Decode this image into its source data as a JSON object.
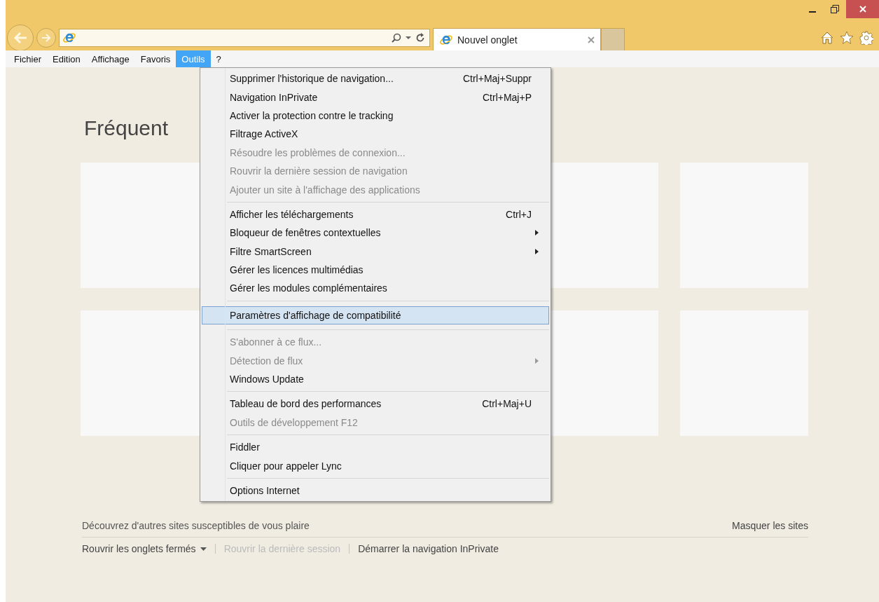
{
  "tab": {
    "title": "Nouvel onglet"
  },
  "menubar": [
    {
      "label": "Fichier",
      "selected": false
    },
    {
      "label": "Edition",
      "selected": false
    },
    {
      "label": "Affichage",
      "selected": false
    },
    {
      "label": "Favoris",
      "selected": false
    },
    {
      "label": "Outils",
      "selected": true
    },
    {
      "label": "?",
      "selected": false
    }
  ],
  "page": {
    "heading": "Fréquent",
    "discover": "Découvrez d'autres sites susceptibles de vous plaire",
    "hide_sites": "Masquer les sites",
    "links": [
      {
        "label": "Rouvrir les onglets fermés",
        "disabled": false,
        "dropdown": true
      },
      {
        "label": "Rouvrir la dernière session",
        "disabled": true,
        "dropdown": false
      },
      {
        "label": "Démarrer la navigation InPrivate",
        "disabled": false,
        "dropdown": false
      }
    ]
  },
  "menu": [
    {
      "kind": "item",
      "label": "Supprimer l'historique de navigation...",
      "shortcut": "Ctrl+Maj+Suppr",
      "disabled": false,
      "selected": false
    },
    {
      "kind": "item",
      "label": "Navigation InPrivate",
      "shortcut": "Ctrl+Maj+P",
      "disabled": false,
      "selected": false
    },
    {
      "kind": "item",
      "label": "Activer la protection contre le tracking",
      "disabled": false,
      "selected": false
    },
    {
      "kind": "item",
      "label": "Filtrage ActiveX",
      "disabled": false,
      "selected": false
    },
    {
      "kind": "item",
      "label": "Résoudre les problèmes de connexion...",
      "disabled": true,
      "selected": false
    },
    {
      "kind": "item",
      "label": "Rouvrir la dernière session de navigation",
      "disabled": true,
      "selected": false
    },
    {
      "kind": "item",
      "label": "Ajouter un site à l'affichage des applications",
      "disabled": true,
      "selected": false
    },
    {
      "kind": "separator"
    },
    {
      "kind": "item",
      "label": "Afficher les téléchargements",
      "shortcut": "Ctrl+J",
      "disabled": false,
      "selected": false
    },
    {
      "kind": "item",
      "label": "Bloqueur de fenêtres contextuelles",
      "submenu": true,
      "disabled": false,
      "selected": false
    },
    {
      "kind": "item",
      "label": "Filtre SmartScreen",
      "submenu": true,
      "disabled": false,
      "selected": false
    },
    {
      "kind": "item",
      "label": "Gérer les licences multimédias",
      "disabled": false,
      "selected": false
    },
    {
      "kind": "item",
      "label": "Gérer les modules complémentaires",
      "disabled": false,
      "selected": false
    },
    {
      "kind": "separator"
    },
    {
      "kind": "item",
      "label": "Paramètres d'affichage de compatibilité",
      "disabled": false,
      "selected": true
    },
    {
      "kind": "separator"
    },
    {
      "kind": "item",
      "label": "S'abonner à ce flux...",
      "disabled": true,
      "selected": false
    },
    {
      "kind": "item",
      "label": "Détection de flux",
      "submenu": true,
      "disabled": true,
      "selected": false
    },
    {
      "kind": "item",
      "label": "Windows Update",
      "disabled": false,
      "selected": false
    },
    {
      "kind": "separator"
    },
    {
      "kind": "item",
      "label": "Tableau de bord des performances",
      "shortcut": "Ctrl+Maj+U",
      "disabled": false,
      "selected": false
    },
    {
      "kind": "item",
      "label": "Outils de développement F12",
      "disabled": true,
      "selected": false
    },
    {
      "kind": "separator"
    },
    {
      "kind": "item",
      "label": "Fiddler",
      "disabled": false,
      "selected": false
    },
    {
      "kind": "item",
      "label": "Cliquer pour appeler Lync",
      "disabled": false,
      "selected": false
    },
    {
      "kind": "separator"
    },
    {
      "kind": "item",
      "label": "Options Internet",
      "disabled": false,
      "selected": false
    }
  ]
}
